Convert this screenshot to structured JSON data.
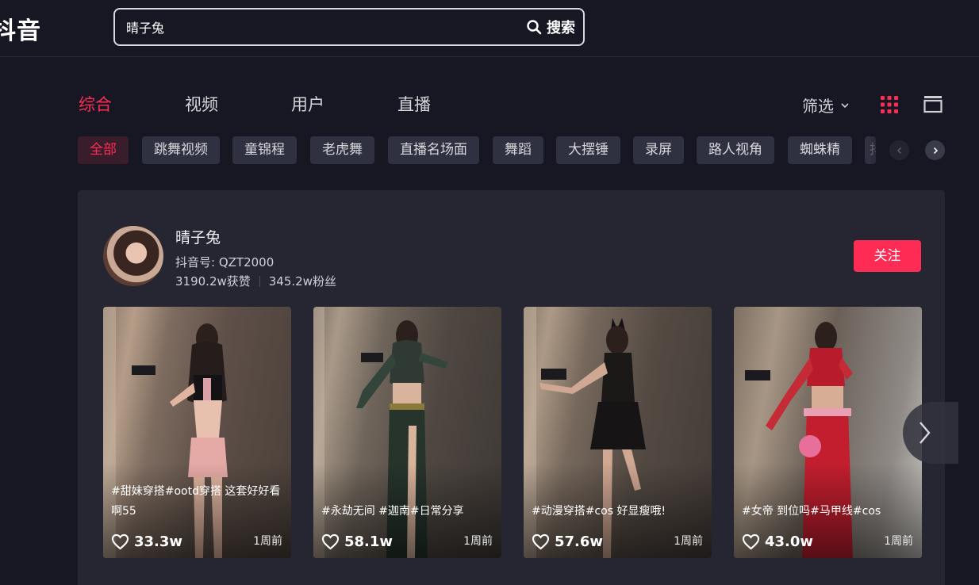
{
  "header": {
    "logo_text": "抖音",
    "search_value": "晴子兔",
    "search_button": "搜索"
  },
  "tabs": [
    {
      "label": "综合",
      "active": true
    },
    {
      "label": "视频",
      "active": false
    },
    {
      "label": "用户",
      "active": false
    },
    {
      "label": "直播",
      "active": false
    }
  ],
  "filter_label": "筛选",
  "chips": [
    {
      "label": "全部",
      "active": true
    },
    {
      "label": "跳舞视频"
    },
    {
      "label": "童锦程"
    },
    {
      "label": "老虎舞"
    },
    {
      "label": "直播名场面"
    },
    {
      "label": "舞蹈"
    },
    {
      "label": "大摆锤"
    },
    {
      "label": "录屏"
    },
    {
      "label": "路人视角"
    },
    {
      "label": "蜘蛛精"
    },
    {
      "label": "抖"
    }
  ],
  "user": {
    "name": "晴子兔",
    "douyin_id": "抖音号: QZT2000",
    "likes": "3190.2w获赞",
    "fans": "345.2w粉丝",
    "follow_label": "关注"
  },
  "videos": [
    {
      "caption": "#甜妹穿搭#ootd穿搭 这套好好看啊55",
      "likes": "33.3w",
      "time": "1周前"
    },
    {
      "caption": "#永劫无间 #迦南#日常分享",
      "likes": "58.1w",
      "time": "1周前"
    },
    {
      "caption": "#动漫穿搭#cos 好显瘦哦!",
      "likes": "57.6w",
      "time": "1周前"
    },
    {
      "caption": "#女帝 到位吗#马甲线#cos",
      "likes": "43.0w",
      "time": "1周前"
    }
  ],
  "colors": {
    "accent": "#fe2c55",
    "background": "#161722",
    "card": "#252632",
    "chip": "#2f3040"
  },
  "icons": [
    "search-icon",
    "chevron-down-icon",
    "grid-view-icon",
    "list-view-icon",
    "chevron-left-icon",
    "chevron-right-icon",
    "heart-icon"
  ]
}
